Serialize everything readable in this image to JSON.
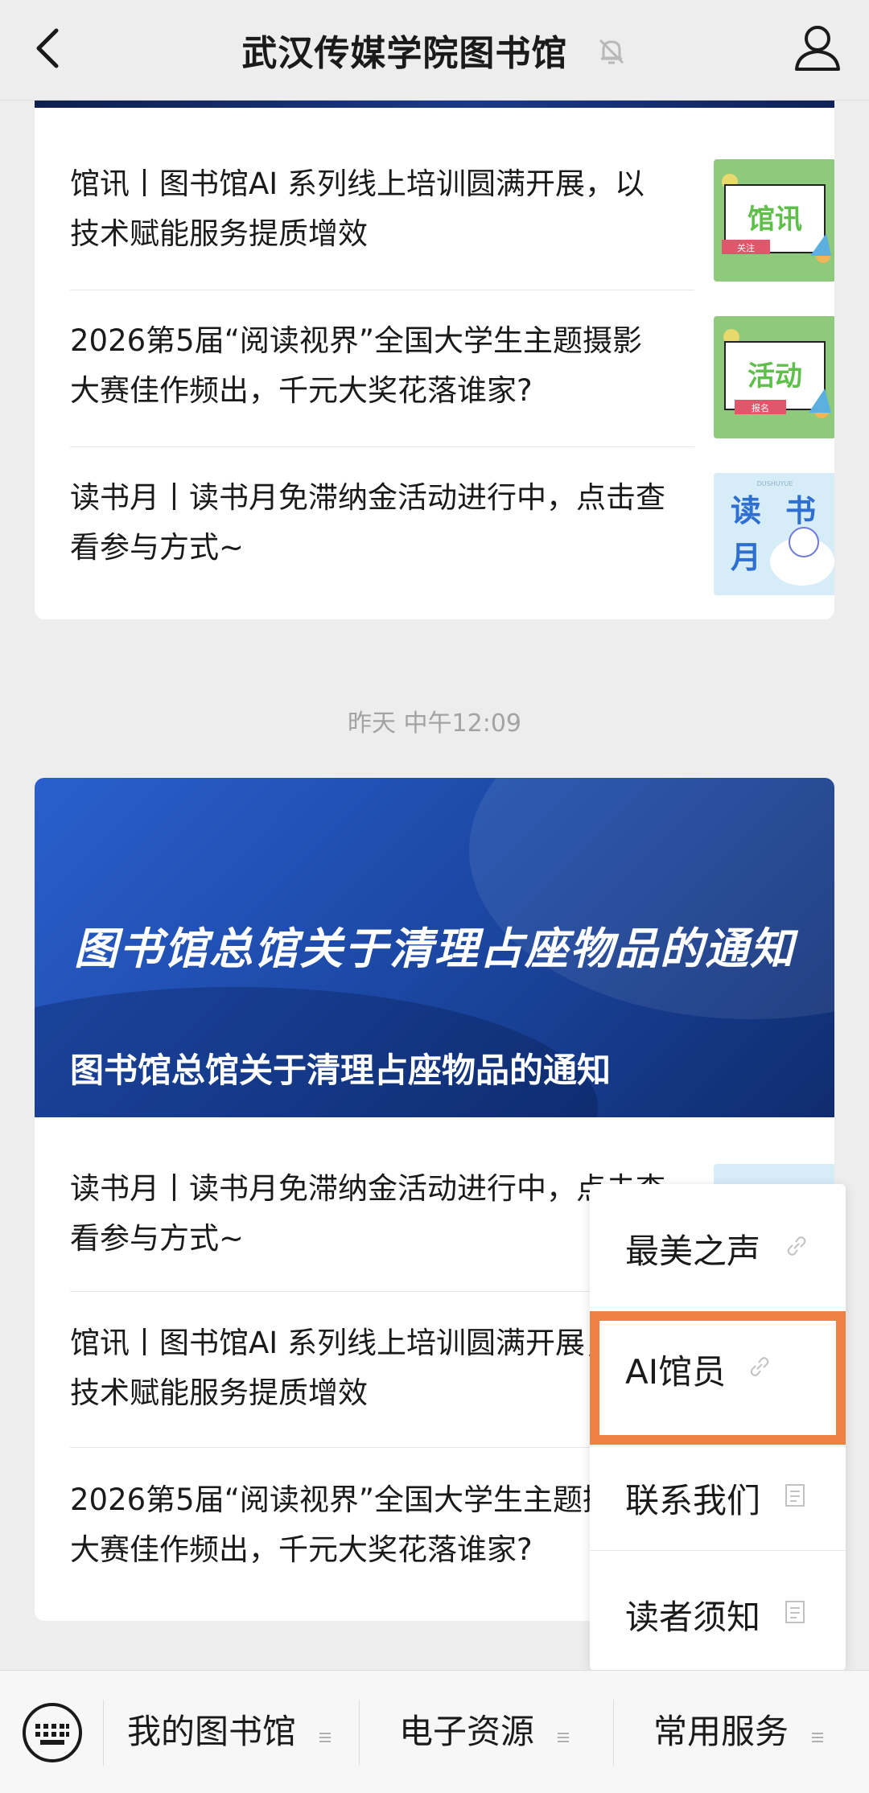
{
  "header": {
    "title": "武汉传媒学院图书馆"
  },
  "card1": {
    "items": [
      {
        "text": "馆讯丨图书馆AI 系列线上培训圆满开展，以技术赋能服务提质增效",
        "thumb": {
          "label": "馆讯",
          "sub": "关注",
          "bg": "#8fc97c"
        }
      },
      {
        "text": "2026第5届“阅读视界”全国大学生主题摄影大赛佳作频出，千元大奖花落谁家?",
        "thumb": {
          "label": "活动",
          "sub": "报名",
          "bg": "#8fc97c"
        }
      },
      {
        "text": "读书月丨读书月免滞纳金活动进行中，点击查看参与方式~",
        "thumb": {
          "label": "读书月",
          "sub": "DUSHUYUE",
          "bg": "#d6ecf7"
        }
      }
    ]
  },
  "timestamp": "昨天 中午12:09",
  "card2": {
    "banner_headline": "图书馆总馆关于清理占座物品的通知",
    "banner_caption": "图书馆总馆关于清理占座物品的通知",
    "items": [
      {
        "text": "读书月丨读书月免滞纳金活动进行中，点击查看参与方式~"
      },
      {
        "text": "馆讯丨图书馆AI 系列线上培训圆满开展，以技术赋能服务提质增效"
      },
      {
        "text": "2026第5届“阅读视界”全国大学生主题摄影大赛佳作频出，千元大奖花落谁家?"
      }
    ]
  },
  "menu": {
    "items": [
      {
        "label": "最美之声",
        "icon": "link-icon"
      },
      {
        "label": "AI馆员",
        "icon": "link-icon"
      },
      {
        "label": "联系我们",
        "icon": "document-icon"
      },
      {
        "label": "读者须知",
        "icon": "document-icon"
      }
    ],
    "highlight_color": "#ef8147"
  },
  "bottom_menu": {
    "items": [
      {
        "label": "我的图书馆"
      },
      {
        "label": "电子资源"
      },
      {
        "label": "常用服务"
      }
    ]
  }
}
